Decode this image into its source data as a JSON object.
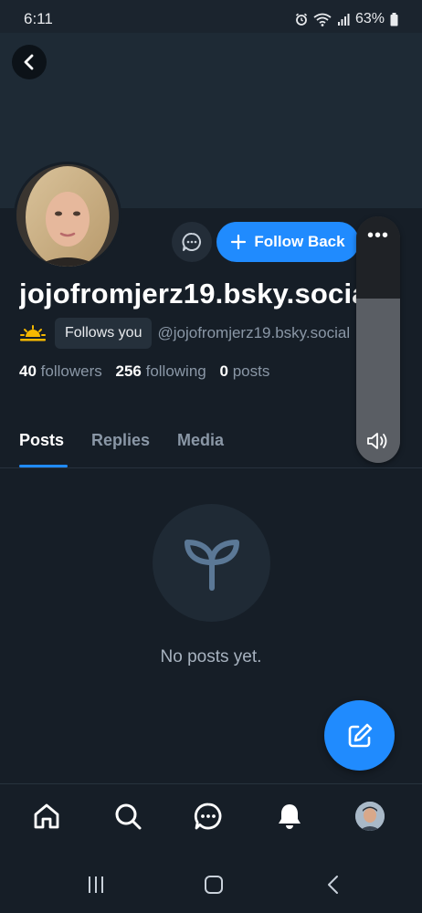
{
  "status_bar": {
    "time": "6:11",
    "battery": "63%",
    "icons": [
      "alarm-icon",
      "wifi-icon",
      "signal-icon",
      "battery-icon"
    ]
  },
  "profile": {
    "display_name": "jojofromjerz19.bsky.social",
    "follows_you_label": "Follows you",
    "handle": "@jojofromjerz19.bsky.social",
    "followers_count": "40",
    "followers_label": "followers",
    "following_count": "256",
    "following_label": "following",
    "posts_count": "0",
    "posts_label": "posts"
  },
  "actions": {
    "follow_back_label": "Follow Back",
    "message_icon": "chat-bubble-icon",
    "more_icon": "more-dots-icon"
  },
  "tabs": [
    {
      "label": "Posts",
      "active": true
    },
    {
      "label": "Replies",
      "active": false
    },
    {
      "label": "Media",
      "active": false
    }
  ],
  "empty_state": {
    "text": "No posts yet.",
    "icon": "sprout-icon"
  },
  "bottom_nav": {
    "items": [
      "home-icon",
      "search-icon",
      "chat-icon",
      "notifications-icon",
      "profile-avatar"
    ]
  },
  "colors": {
    "accent": "#208bfe",
    "background": "#161e27",
    "banner": "#1e2a35",
    "muted_text": "#8a97a6"
  }
}
